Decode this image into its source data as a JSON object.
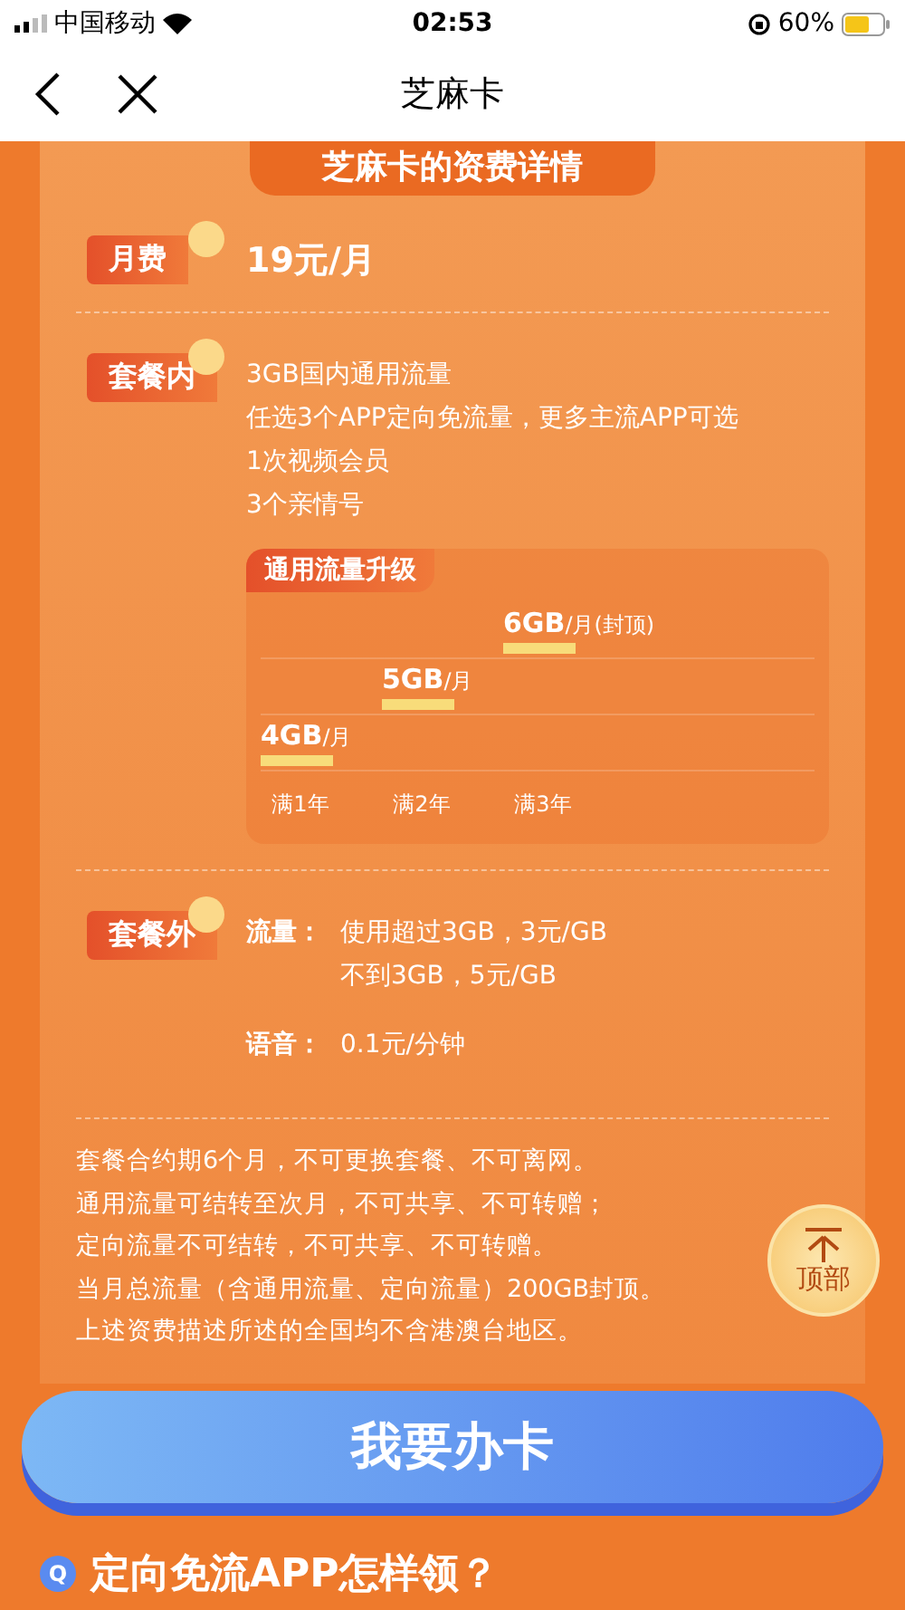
{
  "status_bar": {
    "carrier": "中国移动",
    "time": "02:53",
    "battery": "60%"
  },
  "nav": {
    "title": "芝麻卡"
  },
  "banner": "芝麻卡的资费详情",
  "sections": [
    {
      "kind": "price",
      "tag": "月费",
      "value": "19元/月"
    },
    {
      "kind": "list",
      "tag": "套餐内",
      "lines": [
        "3GB国内通用流量",
        "任选3个APP定向免流量，更多主流APP可选",
        "1次视频会员",
        "3个亲情号"
      ],
      "upgrade": {
        "title": "通用流量升级",
        "steps": [
          {
            "amount": "4GB",
            "unit": "/月"
          },
          {
            "amount": "5GB",
            "unit": "/月"
          },
          {
            "amount": "6GB",
            "unit": "/月(封顶)"
          }
        ],
        "years": [
          "满1年",
          "满2年",
          "满3年"
        ]
      }
    },
    {
      "kind": "fees",
      "tag": "套餐外",
      "rows": [
        {
          "label": "流量：",
          "lines": [
            "使用超过3GB，3元/GB",
            "不到3GB，5元/GB"
          ]
        },
        {
          "label": "语音：",
          "lines": [
            "0.1元/分钟"
          ]
        }
      ]
    }
  ],
  "notes": [
    "套餐合约期6个月，不可更换套餐、不可离网。",
    "通用流量可结转至次月，不可共享、不可转赠；",
    "定向流量不可结转，不可共享、不可转赠。",
    "当月总流量（含通用流量、定向流量）200GB封顶。",
    "上述资费描述所述的全国均不含港澳台地区。"
  ],
  "back_to_top": "顶部",
  "apply_button": "我要办卡",
  "faq": {
    "badge": "Q",
    "title": "定向免流APP怎样领？"
  }
}
